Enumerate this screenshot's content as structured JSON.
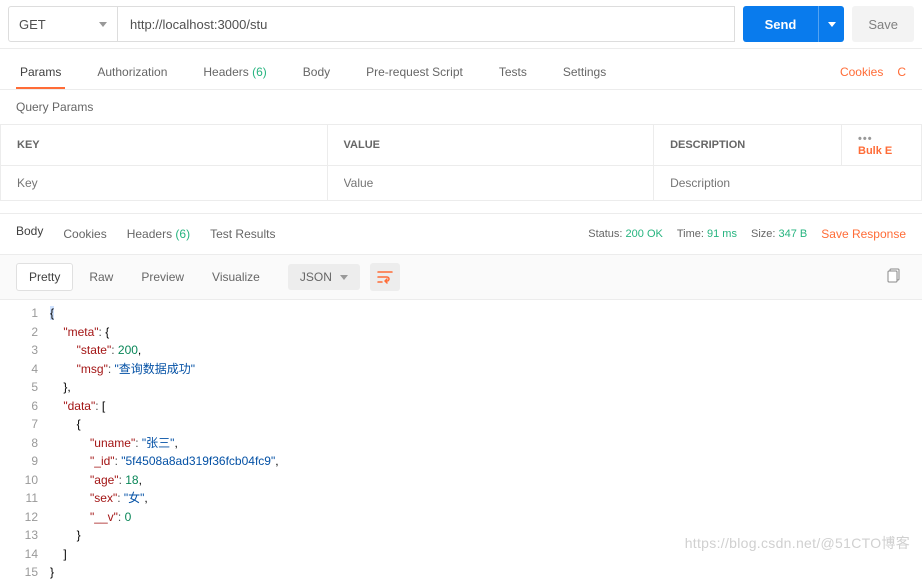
{
  "request": {
    "method": "GET",
    "url": "http://localhost:3000/stu",
    "send_label": "Send",
    "save_label": "Save"
  },
  "req_tabs": {
    "params": "Params",
    "auth": "Authorization",
    "headers": "Headers",
    "headers_count": "(6)",
    "body": "Body",
    "prereq": "Pre-request Script",
    "tests": "Tests",
    "settings": "Settings",
    "cookies": "Cookies",
    "code_partial": "C"
  },
  "query_params": {
    "title": "Query Params",
    "cols": {
      "key": "KEY",
      "value": "VALUE",
      "desc": "DESCRIPTION"
    },
    "placeholders": {
      "key": "Key",
      "value": "Value",
      "desc": "Description"
    },
    "bulk": "Bulk E",
    "dots": "•••"
  },
  "resp_tabs": {
    "body": "Body",
    "cookies": "Cookies",
    "headers": "Headers",
    "headers_count": "(6)",
    "tests": "Test Results"
  },
  "status": {
    "label": "Status:",
    "value": "200 OK",
    "time_label": "Time:",
    "time_value": "91 ms",
    "size_label": "Size:",
    "size_value": "347 B",
    "save_resp": "Save Response"
  },
  "view": {
    "pretty": "Pretty",
    "raw": "Raw",
    "preview": "Preview",
    "visualize": "Visualize",
    "format": "JSON"
  },
  "json_response": {
    "meta": {
      "state": 200,
      "msg": "查询数据成功"
    },
    "data": [
      {
        "uname": "张三",
        "_id": "5f4508a8ad319f36fcb04fc9",
        "age": 18,
        "sex": "女",
        "__v": 0
      }
    ]
  },
  "code_lines": [
    "{",
    "    \"meta\": {",
    "        \"state\": 200,",
    "        \"msg\": \"查询数据成功\"",
    "    },",
    "    \"data\": [",
    "        {",
    "            \"uname\": \"张三\",",
    "            \"_id\": \"5f4508a8ad319f36fcb04fc9\",",
    "            \"age\": 18,",
    "            \"sex\": \"女\",",
    "            \"__v\": 0",
    "        }",
    "    ]",
    "}"
  ],
  "watermark": "https://blog.csdn.net/@51CTO博客"
}
